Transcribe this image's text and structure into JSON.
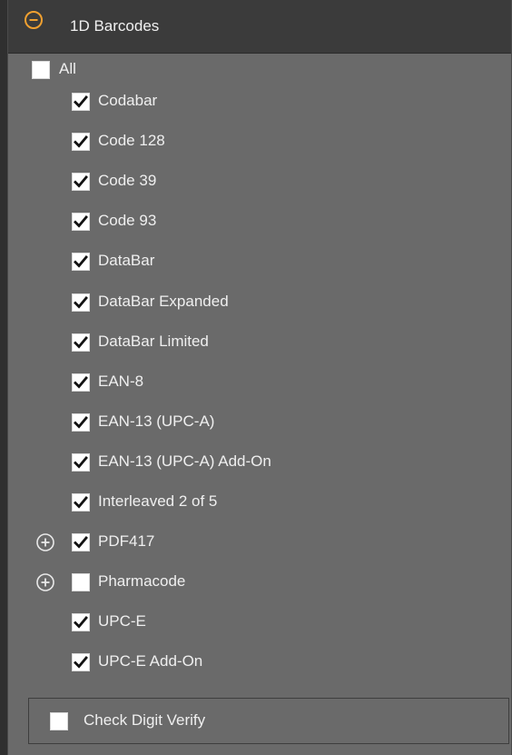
{
  "section": {
    "title": "1D Barcodes",
    "collapse_icon": "minus-circle-icon",
    "accent_color": "#f0a030"
  },
  "all_option": {
    "label": "All",
    "checked": false
  },
  "items": [
    {
      "label": "Codabar",
      "checked": true,
      "expandable": false
    },
    {
      "label": "Code 128",
      "checked": true,
      "expandable": false
    },
    {
      "label": "Code 39",
      "checked": true,
      "expandable": false
    },
    {
      "label": "Code 93",
      "checked": true,
      "expandable": false
    },
    {
      "label": "DataBar",
      "checked": true,
      "expandable": false
    },
    {
      "label": "DataBar Expanded",
      "checked": true,
      "expandable": false
    },
    {
      "label": "DataBar Limited",
      "checked": true,
      "expandable": false
    },
    {
      "label": "EAN-8",
      "checked": true,
      "expandable": false
    },
    {
      "label": "EAN-13 (UPC-A)",
      "checked": true,
      "expandable": false
    },
    {
      "label": "EAN-13 (UPC-A) Add-On",
      "checked": true,
      "expandable": false
    },
    {
      "label": "Interleaved 2 of 5",
      "checked": true,
      "expandable": false
    },
    {
      "label": "PDF417",
      "checked": true,
      "expandable": true
    },
    {
      "label": "Pharmacode",
      "checked": false,
      "expandable": true
    },
    {
      "label": "UPC-E",
      "checked": true,
      "expandable": false
    },
    {
      "label": "UPC-E Add-On",
      "checked": true,
      "expandable": false
    }
  ],
  "check_digit": {
    "label": "Check Digit Verify",
    "checked": false
  }
}
